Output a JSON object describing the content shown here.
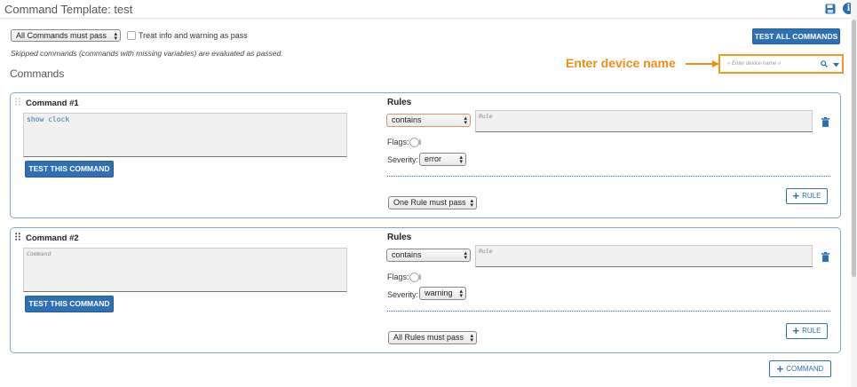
{
  "header": {
    "title": "Command Template: test",
    "save_icon": "save-icon",
    "info_icon": "info-icon",
    "info_glyph": "i"
  },
  "toolbar": {
    "pass_mode": "All Commands must pass",
    "treat_info_label": "Treat info and warning as pass",
    "skipped_note": "Skipped commands (commands with missing variables) are evaluated as passed.",
    "test_all_label": "TEST ALL COMMANDS"
  },
  "device": {
    "placeholder": "« Enter device name »",
    "callout": "Enter device name"
  },
  "section_title": "Commands",
  "commands": [
    {
      "title": "Command #1",
      "command_value": "show clock",
      "command_placeholder": "",
      "test_label": "TEST THIS COMMAND",
      "rules_title": "Rules",
      "operator": "contains",
      "rule_placeholder": "Rule",
      "flags_label": "Flags:",
      "flags_value": "i",
      "severity_label": "Severity:",
      "severity": "error",
      "rule_mode": "One Rule must pass",
      "add_rule_label": "RULE"
    },
    {
      "title": "Command #2",
      "command_value": "",
      "command_placeholder": "Command",
      "test_label": "TEST THIS COMMAND",
      "rules_title": "Rules",
      "operator": "contains",
      "rule_placeholder": "Rule",
      "flags_label": "Flags:",
      "flags_value": "i",
      "severity_label": "Severity:",
      "severity": "warning",
      "rule_mode": "All Rules must pass",
      "add_rule_label": "RULE"
    }
  ],
  "add_command_label": "COMMAND",
  "colors": {
    "primary": "#2e70b3",
    "highlight": "#f39a1f",
    "danger_icon": "#2e70b3"
  }
}
